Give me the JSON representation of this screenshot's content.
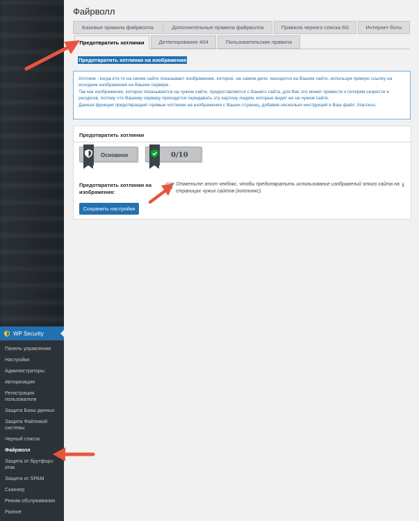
{
  "page": {
    "title": "Файрволл",
    "section_title": "Предотвратить хотлинки на изображения"
  },
  "tabs_row1": [
    {
      "label": "Базовые правила файрволла"
    },
    {
      "label": "Дополнительные правила файрволла"
    },
    {
      "label": "Правила черного списка 6G"
    },
    {
      "label": "Интернет-боты"
    }
  ],
  "tabs_row2": [
    {
      "label": "Предотвратить хотлинки",
      "active": true
    },
    {
      "label": "Детектирование 404"
    },
    {
      "label": "Пользовательские правила"
    }
  ],
  "info": {
    "line1": "Хотлинк - когда кто-то на своем сайте показывает изображение, которое, на самом деле, находится на Вашем сайте, используя прямую ссылку на исходник изображения на Вашем сервере.",
    "line2": "Так как изображение, которое показывается на чужом сайте, предоставляется с Вашего сайта, для Вас это может привести к потерям скорости и ресурсов, потому что Вашему серверу приходится передавать эту картину людям, которые видят ее на чужом сайте.",
    "line3": "Данная функция предотвращает прямые хотлинки на изображения с Ваших страниц, добавив несколько инструкций в Ваш файл .htaccess."
  },
  "postbox": {
    "title": "Предотвратить хотлинки",
    "badge_level": "Основное",
    "badge_points": "0/10",
    "field_label": "Предотвратить хотлинки на изображения:",
    "checkbox_checked": true,
    "field_desc": "Отметьте этот чекбокс, чтобы предотвратить использование изображений этого сайта на страницах чужих сайтов (хотлинкс).",
    "info_mark": "i",
    "save_label": "Сохранить настройки"
  },
  "sidebar": {
    "menu_title": "WP Security",
    "items": [
      {
        "label": "Панель управления"
      },
      {
        "label": "Настройки"
      },
      {
        "label": "Администраторы"
      },
      {
        "label": "Авторизация"
      },
      {
        "label": "Регистрация пользователя"
      },
      {
        "label": "Защита Базы данных"
      },
      {
        "label": "Защита Файловой системы"
      },
      {
        "label": "Черный список"
      },
      {
        "label": "Файрволл",
        "active": true
      },
      {
        "label": "Защита от брутфорс-атак"
      },
      {
        "label": "Защита от SPAM"
      },
      {
        "label": "Сканнер"
      },
      {
        "label": "Режим обслуживания"
      },
      {
        "label": "Разное"
      }
    ]
  },
  "colors": {
    "accent": "#2271b1",
    "sidebar_bg": "#1d2327",
    "arrow": "#e8553e"
  }
}
